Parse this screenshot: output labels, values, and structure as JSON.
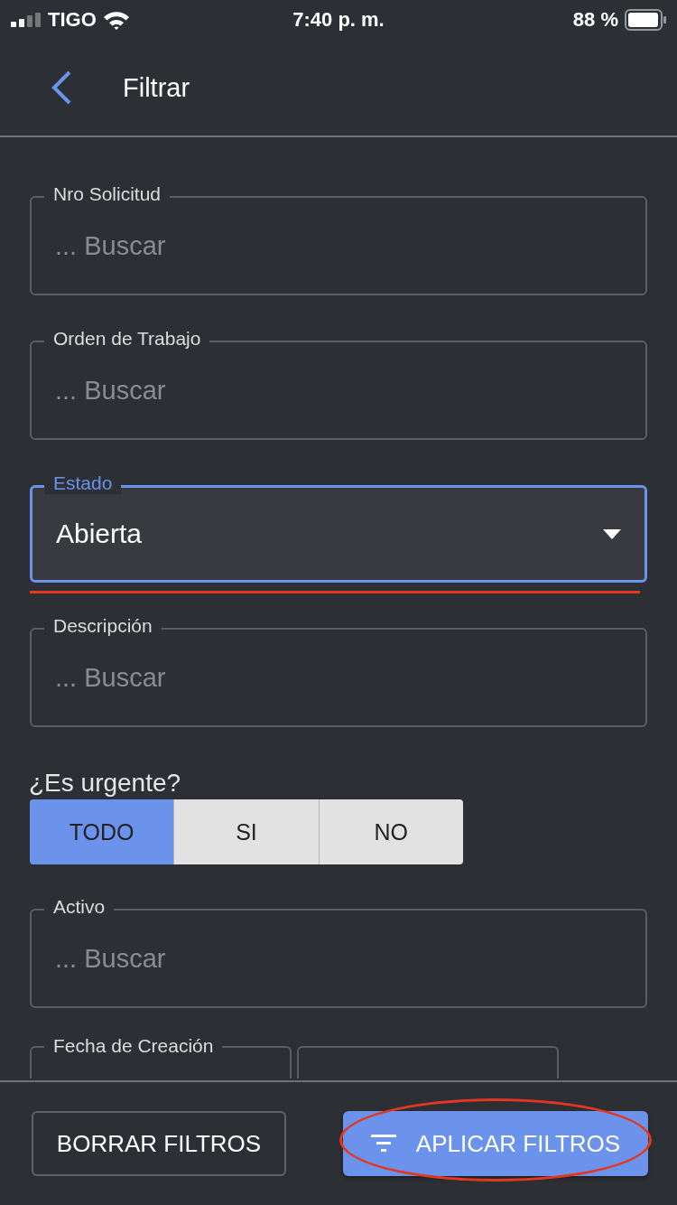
{
  "status_bar": {
    "carrier": "TIGO",
    "time": "7:40 p. m.",
    "battery": "88 %"
  },
  "header": {
    "title": "Filtrar"
  },
  "fields": [
    {
      "kind": "text",
      "label": "Nro Solicitud",
      "placeholder": "... Buscar",
      "focused": false
    },
    {
      "kind": "text",
      "label": "Orden de Trabajo",
      "placeholder": "... Buscar",
      "focused": false
    },
    {
      "kind": "select",
      "label": "Estado",
      "value": "Abierta",
      "focused": true
    },
    {
      "kind": "text",
      "label": "Descripción",
      "placeholder": "... Buscar",
      "focused": false
    }
  ],
  "urgent": {
    "label": "¿Es urgente?",
    "options": [
      {
        "label": "TODO",
        "selected": true
      },
      {
        "label": "SI",
        "selected": false
      },
      {
        "label": "NO",
        "selected": false
      }
    ]
  },
  "fields_2": [
    {
      "kind": "text",
      "label": "Activo",
      "placeholder": "... Buscar",
      "focused": false
    }
  ],
  "date_range": {
    "label": "Fecha de Creación"
  },
  "buttons": [
    {
      "kind": "outline",
      "label": "BORRAR FILTROS"
    },
    {
      "kind": "primary",
      "label": "APLICAR FILTROS"
    }
  ]
}
